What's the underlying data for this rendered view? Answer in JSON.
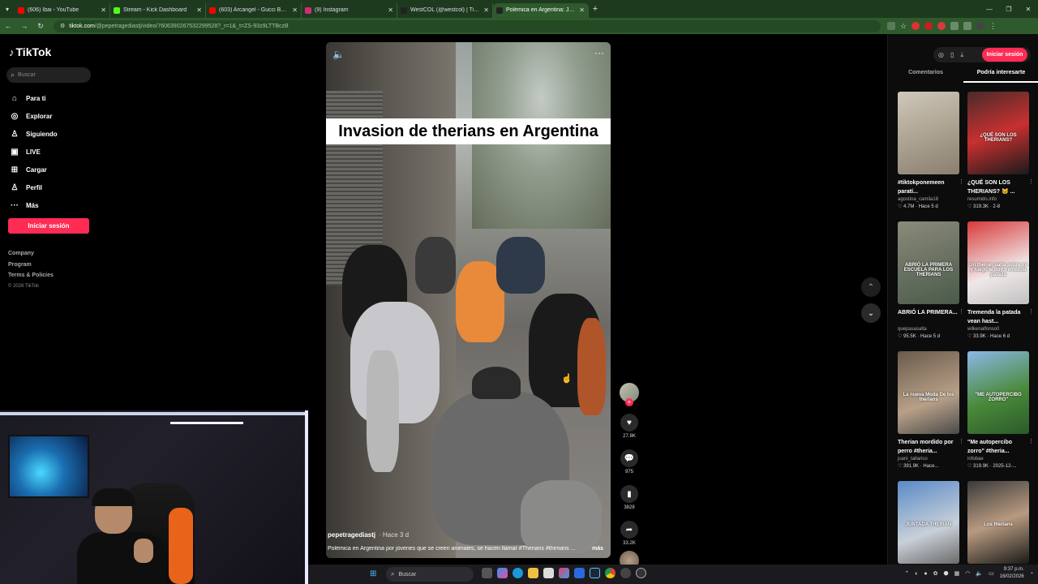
{
  "browser": {
    "tabs": [
      {
        "label": "(606) Ibai - YouTube",
        "color": "#ff0000",
        "active": false
      },
      {
        "label": "Stream - Kick Dashboard",
        "color": "#53fc18",
        "active": false
      },
      {
        "label": "(603) Arcangel - Gucci Boys Cli",
        "color": "#ff0000",
        "active": false
      },
      {
        "label": "(9) Instagram",
        "color": "#d62976",
        "active": false
      },
      {
        "label": "WestCOL (@westcol) | TikTok",
        "color": "#222222",
        "active": false
      },
      {
        "label": "Polémica en Argentina: Jóvene",
        "color": "#222222",
        "active": true
      }
    ],
    "url_domain": "tiktok.com",
    "url_path": "/@pepetragediastj/video/7606390267532299528?_r=1&_t=ZS-93z9LTTBczB"
  },
  "sidebar": {
    "logo": "TikTok",
    "search_placeholder": "Buscar",
    "nav": [
      {
        "label": "Para ti",
        "icon": "home-icon",
        "glyph": "⌂"
      },
      {
        "label": "Explorar",
        "icon": "compass-icon",
        "glyph": "◎"
      },
      {
        "label": "Siguiendo",
        "icon": "user-follow-icon",
        "glyph": "♙"
      },
      {
        "label": "LIVE",
        "icon": "live-icon",
        "glyph": "▣"
      },
      {
        "label": "Cargar",
        "icon": "upload-icon",
        "glyph": "⊞"
      },
      {
        "label": "Perfil",
        "icon": "profile-icon",
        "glyph": "♙"
      },
      {
        "label": "Más",
        "icon": "more-icon",
        "glyph": "···"
      }
    ],
    "login_label": "Iniciar sesión",
    "footer": [
      "Company",
      "Program",
      "Terms & Policies"
    ],
    "copyright": "© 2026 TikTok"
  },
  "video": {
    "caption_overlay": "Invasion de therians en Argentina",
    "author": "pepetragediastj",
    "time": "Hace 3 d",
    "description": "Polémica en Argentina por jóvenes que se creen animales, se hacen llamar #Therians #therians ...",
    "more_label": "más",
    "likes": "27.8K",
    "comments": "975",
    "saves": "3828",
    "shares": "33.2K"
  },
  "right_panel": {
    "login_label": "Iniciar sesión",
    "tabs": [
      "Comentarios",
      "Podría interesarte"
    ],
    "cards": [
      {
        "title": "#tiktokponemeen paratí...",
        "author": "agostina_camila18",
        "meta": "♡ 4.7M · Hace 5 d",
        "overlay": "",
        "bg": "linear-gradient(160deg,#cfc7b8,#8a7f6e)"
      },
      {
        "title": "¿QUÉ SON LOS THERIANS? 🐱 ...",
        "author": "resumido.info",
        "meta": "♡ 319.3K · 2-8",
        "overlay": "¿QUÉ SON LOS THERIANS?",
        "bg": "linear-gradient(160deg,#4a2a2a,#c83030 50%,#1a1a1a)"
      },
      {
        "title": "ABRIÓ LA PRIMERA...",
        "author": "quepasasalta",
        "meta": "♡ 95.5K · Hace 5 d",
        "overlay": "ABRIÓ LA PRIMERA ESCUELA PARA LOS THERIANS",
        "bg": "linear-gradient(160deg,#8a8a7a,#4a5a4a)"
      },
      {
        "title": "Tremenda la patada vean hast...",
        "author": "wilkenalfonso0",
        "meta": "♡ 33.9K · Hace 6 d",
        "overlay": "Un therian salta sobre mí y luego le doy tremenda patada",
        "bg": "linear-gradient(160deg,#d83a3a,#f0e8e8 60%,#c0c0c0)"
      },
      {
        "title": "Therian mordido por perro #theria...",
        "author": "juani_tallarico",
        "meta": "♡ 391.9K · Hace...",
        "overlay": "La nueva Moda De los therians",
        "bg": "linear-gradient(160deg,#6a5a4a,#b8a088 60%,#4a4a4a)"
      },
      {
        "title": "\"Me autopercibo zorro\" #theria...",
        "author": "infobae",
        "meta": "♡ 319.9K · 2025-12-...",
        "overlay": "\"ME AUTOPERCIBO ZORRO\"",
        "bg": "linear-gradient(160deg,#8ab8e8,#4a8a3a 55%,#2a5a2a)"
      },
      {
        "title": "",
        "author": "",
        "meta": "",
        "overlay": "JUNTADA THERIAN",
        "bg": "linear-gradient(160deg,#5a8ac8,#c8d0d8 60%,#6a6a6a)"
      },
      {
        "title": "",
        "author": "",
        "meta": "",
        "overlay": "Los therians",
        "bg": "linear-gradient(160deg,#3a3a3a,#b89a80 50%,#1a1a1a)"
      }
    ]
  },
  "taskbar": {
    "search_placeholder": "Buscar",
    "time": "9:37 p.m.",
    "date": "16/02/2026"
  }
}
